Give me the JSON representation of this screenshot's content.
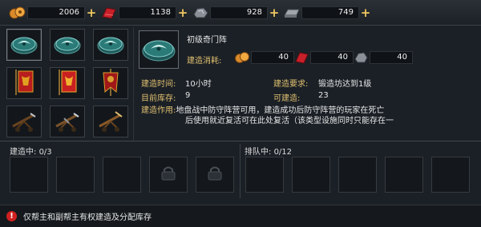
{
  "resources": [
    {
      "icon": "copper-coins-icon",
      "value": "2006"
    },
    {
      "icon": "red-fabric-icon",
      "value": "1138"
    },
    {
      "icon": "ore-stone-icon",
      "value": "928"
    },
    {
      "icon": "iron-ingot-icon",
      "value": "749"
    }
  ],
  "add_symbol": "+",
  "items": [
    {
      "icon": "taiji-array-icon"
    },
    {
      "icon": "taiji-array-icon"
    },
    {
      "icon": "taiji-array-icon"
    },
    {
      "icon": "war-banner-icon"
    },
    {
      "icon": "war-banner-icon"
    },
    {
      "icon": "war-banner-icon"
    },
    {
      "icon": "ballista-icon"
    },
    {
      "icon": "ballista-icon"
    },
    {
      "icon": "ballista-icon"
    }
  ],
  "detail": {
    "name": "初级奇门阵",
    "cost_label": "建造消耗:",
    "costs": [
      {
        "icon": "copper-coins-icon",
        "value": "40"
      },
      {
        "icon": "red-fabric-icon",
        "value": "40"
      },
      {
        "icon": "ore-stone-icon",
        "value": "40"
      }
    ],
    "build_time_label": "建造时间:",
    "build_time": "10小时",
    "requirement_label": "建造要求:",
    "requirement": "锻造坊达到1级",
    "stock_label": "目前库存:",
    "stock": "9",
    "buildable_label": "可建造:",
    "buildable": "23",
    "effect_label": "建造作用:",
    "effect_line1": "地盘战中防守阵营可用，建造成功后防守阵营的玩家在死亡",
    "effect_line2": "后使用就近复活可在此处复活（该类型设施同时只能存在一"
  },
  "queue": {
    "building_label": "建造中:",
    "building_count": "0/3",
    "waiting_label": "排队中:",
    "waiting_count": "0/12"
  },
  "notice": {
    "icon": "warning-icon",
    "symbol": "!",
    "text": "仅帮主和副帮主有权建造及分配库存"
  }
}
